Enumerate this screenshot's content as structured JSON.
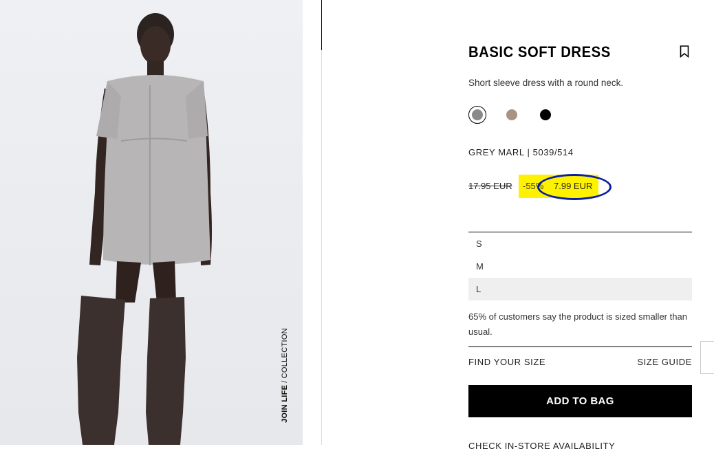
{
  "product": {
    "title": "BASIC SOFT DRESS",
    "description": "Short sleeve dress with a round neck.",
    "color_ref": "GREY MARL | 5039/514",
    "old_price": "17.95 EUR",
    "discount": "-55%",
    "new_price": "7.99 EUR"
  },
  "colors": [
    {
      "name": "grey marl",
      "hex": "#8a8a8a",
      "selected": true
    },
    {
      "name": "taupe",
      "hex": "#a89282",
      "selected": false
    },
    {
      "name": "black",
      "hex": "#000000",
      "selected": false
    }
  ],
  "sizes": [
    {
      "label": "S",
      "selected": false
    },
    {
      "label": "M",
      "selected": false
    },
    {
      "label": "L",
      "selected": true
    }
  ],
  "fit_note": "65% of customers say the product is sized smaller than usual.",
  "links": {
    "find_size": "FIND YOUR SIZE",
    "size_guide": "SIZE GUIDE",
    "check_store": "CHECK IN-STORE AVAILABILITY"
  },
  "add_to_bag_label": "ADD TO BAG",
  "image": {
    "collection_brand": "JOIN LIFE",
    "collection_sep": "/",
    "collection_label": "COLLECTION"
  },
  "theme": {
    "highlight": "#fff200",
    "annotation_ring": "#0a1f9e"
  },
  "icons": [
    "bookmark-icon"
  ]
}
